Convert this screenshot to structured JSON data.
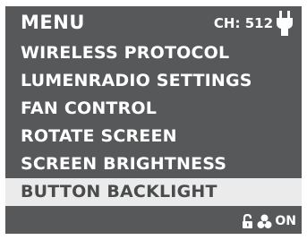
{
  "header": {
    "title": "MENU",
    "channel": "CH: 512",
    "power_icon": "plug-icon"
  },
  "menu": {
    "items": [
      {
        "label": "WIRELESS PROTOCOL",
        "selected": false
      },
      {
        "label": "LUMENRADIO SETTINGS",
        "selected": false
      },
      {
        "label": "FAN CONTROL",
        "selected": false
      },
      {
        "label": "ROTATE SCREEN",
        "selected": false
      },
      {
        "label": "SCREEN BRIGHTNESS",
        "selected": false
      },
      {
        "label": "BUTTON BACKLIGHT",
        "selected": true
      }
    ]
  },
  "status": {
    "icons": [
      "unlocked-icon",
      "fan-icon"
    ],
    "state": "ON"
  },
  "colors": {
    "screen_background": "#56585a",
    "selected_background": "#ebebeb",
    "selected_text": "#4a4b4d",
    "text": "#ffffff"
  }
}
